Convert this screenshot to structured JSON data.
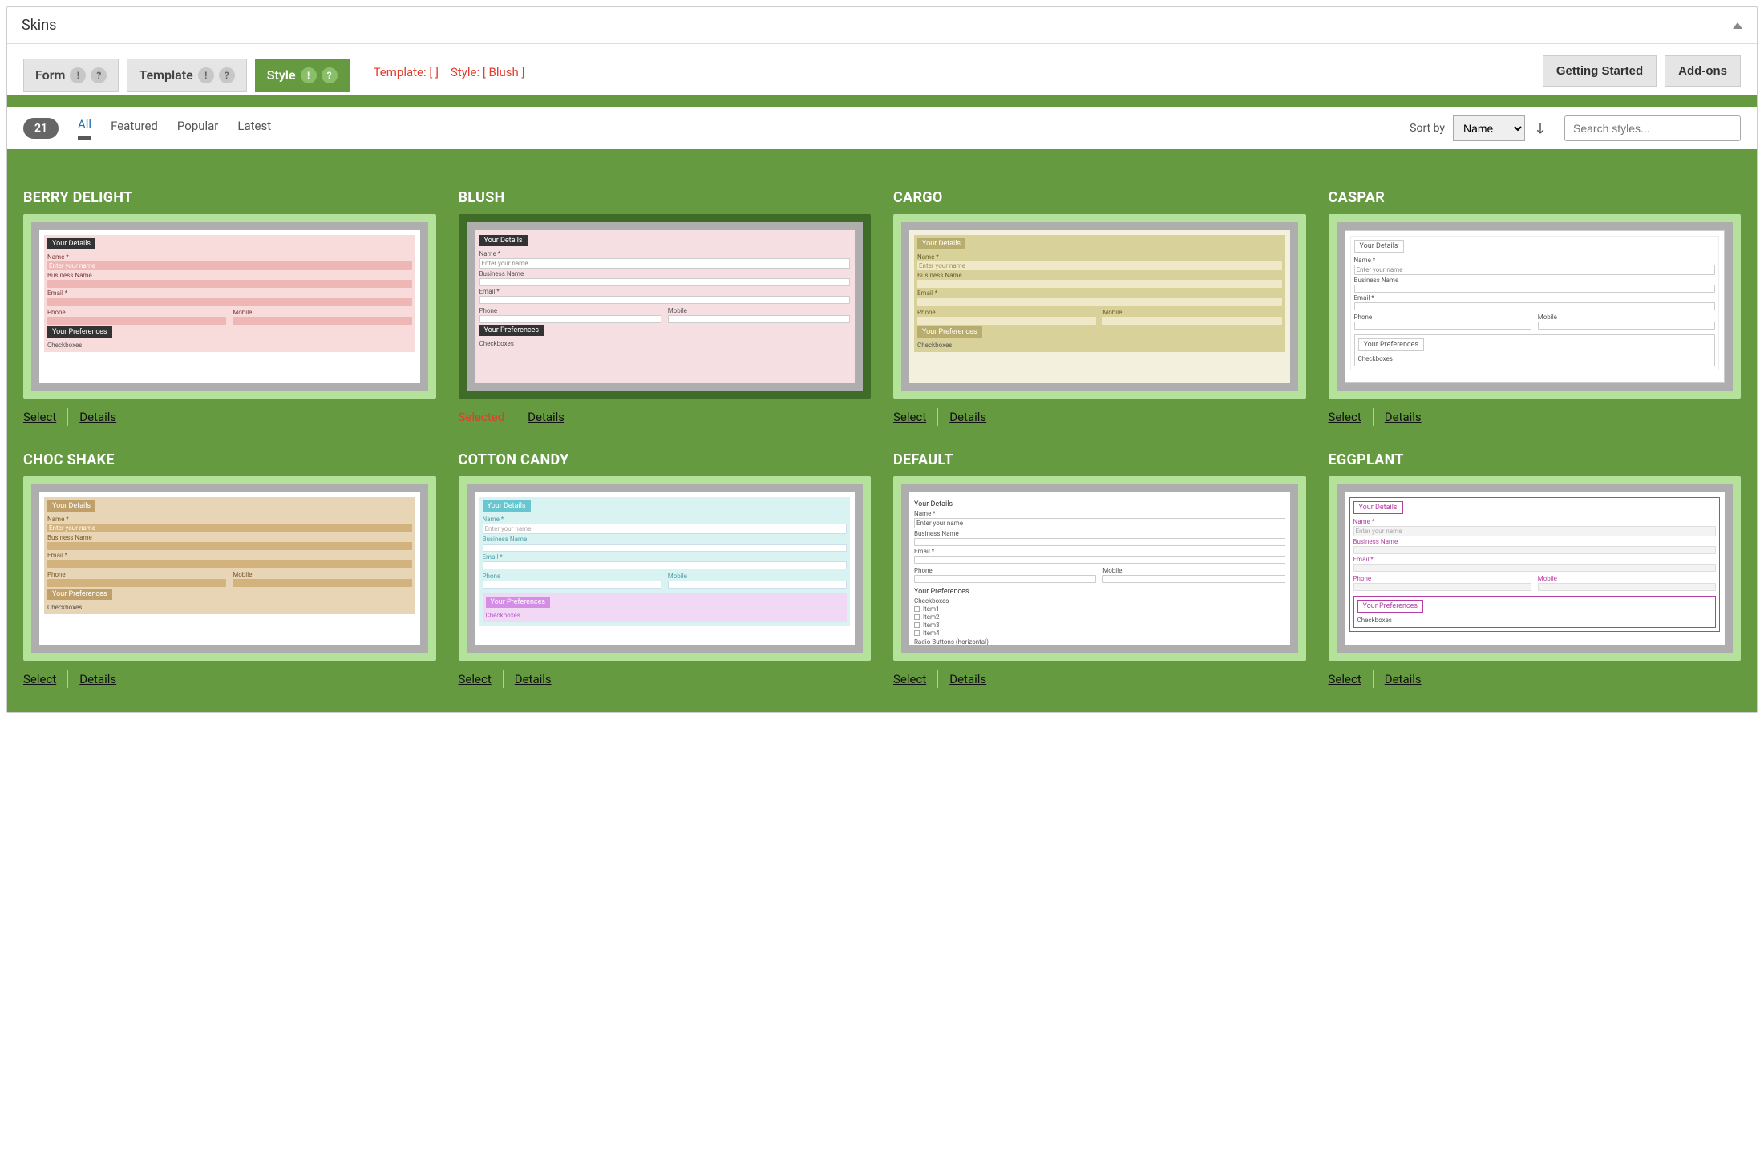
{
  "panel": {
    "title": "Skins"
  },
  "tabs": {
    "form": "Form",
    "template": "Template",
    "style": "Style",
    "icon_info": "!",
    "icon_help": "?"
  },
  "status": {
    "template_label": "Template:",
    "template_value": "[  ]",
    "style_label": "Style:",
    "style_value": "[ Blush ]"
  },
  "header_buttons": {
    "getting_started": "Getting Started",
    "addons": "Add-ons"
  },
  "filters": {
    "count": "21",
    "all": "All",
    "featured": "Featured",
    "popular": "Popular",
    "latest": "Latest"
  },
  "sort": {
    "label": "Sort by",
    "value": "Name"
  },
  "search": {
    "placeholder": "Search styles..."
  },
  "actions": {
    "select": "Select",
    "details": "Details",
    "selected": "Selected"
  },
  "preview": {
    "your_details": "Your Details",
    "your_preferences": "Your Preferences",
    "name": "Name *",
    "enter_name": "Enter your name",
    "business": "Business Name",
    "email": "Email *",
    "phone": "Phone",
    "mobile": "Mobile",
    "checkboxes": "Checkboxes",
    "item1": "Item1",
    "item2": "Item2",
    "item3": "Item3",
    "item4": "Item4",
    "radio_h": "Radio Buttons (horizontal)"
  },
  "cards": [
    {
      "title": "BERRY DELIGHT",
      "theme": "th-berry",
      "selected": false
    },
    {
      "title": "BLUSH",
      "theme": "th-blush",
      "selected": true
    },
    {
      "title": "CARGO",
      "theme": "th-cargo",
      "selected": false
    },
    {
      "title": "CASPAR",
      "theme": "th-caspar",
      "selected": false
    },
    {
      "title": "CHOC SHAKE",
      "theme": "th-choc",
      "selected": false
    },
    {
      "title": "COTTON CANDY",
      "theme": "th-cotton",
      "selected": false
    },
    {
      "title": "DEFAULT",
      "theme": "th-default",
      "selected": false
    },
    {
      "title": "EGGPLANT",
      "theme": "th-eggplant",
      "selected": false
    }
  ]
}
